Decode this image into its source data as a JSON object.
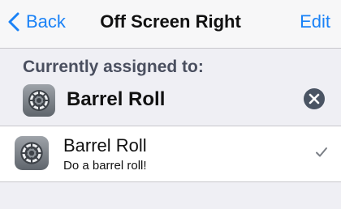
{
  "navbar": {
    "back_label": "Back",
    "title": "Off Screen Right",
    "edit_label": "Edit"
  },
  "section": {
    "title": "Currently assigned to:",
    "assigned_name": "Barrel Roll"
  },
  "list": {
    "items": [
      {
        "title": "Barrel Roll",
        "subtitle": "Do a barrel roll!",
        "icon": "settings-gear-icon",
        "checked": true
      }
    ]
  },
  "colors": {
    "accent": "#1a82f7",
    "background": "#efeff4",
    "header_text": "#4a4f5f",
    "clear_button": "#4a5463"
  }
}
